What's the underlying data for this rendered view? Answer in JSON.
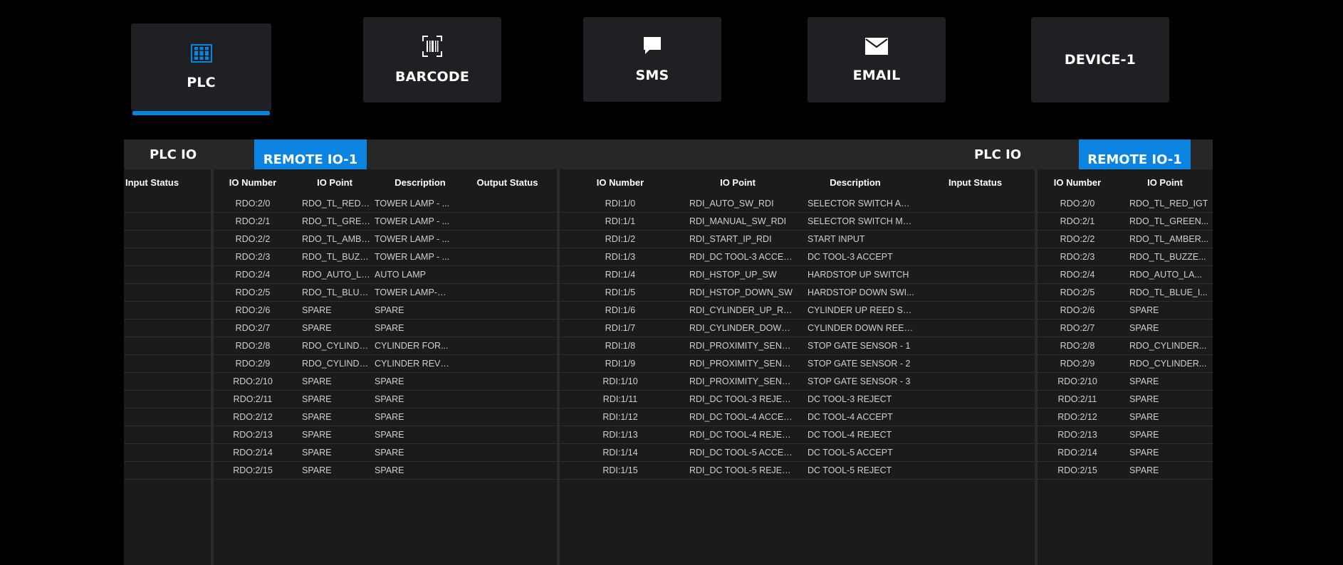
{
  "tabs": [
    {
      "key": "plc",
      "label": "PLC",
      "icon": "plc-icon",
      "active": true
    },
    {
      "key": "barcode",
      "label": "BARCODE",
      "icon": "barcode-icon",
      "active": false
    },
    {
      "key": "sms",
      "label": "SMS",
      "icon": "sms-icon",
      "active": false
    },
    {
      "key": "email",
      "label": "EMAIL",
      "icon": "email-icon",
      "active": false
    },
    {
      "key": "device1",
      "label": "DEVICE-1",
      "icon": "",
      "active": false
    }
  ],
  "colors": {
    "accent": "#0a84e0",
    "panel": "#1d1d1d",
    "tile": "#1f2023"
  },
  "panel": {
    "left_tab": "PLC IO",
    "left_active_tab": "REMOTE IO-1",
    "right_tab": "PLC IO",
    "right_active_tab": "REMOTE IO-1"
  },
  "tables": {
    "input_status_left": {
      "header": "Input Status"
    },
    "remote_out": {
      "headers": [
        "IO Number",
        "IO Point",
        "Description",
        "Output Status"
      ],
      "rows": [
        [
          "RDO:2/0",
          "RDO_TL_RED_IGT",
          "TOWER LAMP - ...",
          ""
        ],
        [
          "RDO:2/1",
          "RDO_TL_GREEN...",
          "TOWER LAMP - ...",
          ""
        ],
        [
          "RDO:2/2",
          "RDO_TL_AMBER...",
          "TOWER LAMP - ...",
          ""
        ],
        [
          "RDO:2/3",
          "RDO_TL_BUZZE...",
          "TOWER LAMP - ...",
          ""
        ],
        [
          "RDO:2/4",
          "RDO_AUTO_LA...",
          "AUTO LAMP",
          ""
        ],
        [
          "RDO:2/5",
          "RDO_TL_BLUE_I...",
          "TOWER LAMP-B...",
          ""
        ],
        [
          "RDO:2/6",
          "SPARE",
          "SPARE",
          ""
        ],
        [
          "RDO:2/7",
          "SPARE",
          "SPARE",
          ""
        ],
        [
          "RDO:2/8",
          "RDO_CYLINDER...",
          "CYLINDER FOR...",
          ""
        ],
        [
          "RDO:2/9",
          "RDO_CYLINDER...",
          "CYLINDER REVE...",
          ""
        ],
        [
          "RDO:2/10",
          "SPARE",
          "SPARE",
          ""
        ],
        [
          "RDO:2/11",
          "SPARE",
          "SPARE",
          ""
        ],
        [
          "RDO:2/12",
          "SPARE",
          "SPARE",
          ""
        ],
        [
          "RDO:2/13",
          "SPARE",
          "SPARE",
          ""
        ],
        [
          "RDO:2/14",
          "SPARE",
          "SPARE",
          ""
        ],
        [
          "RDO:2/15",
          "SPARE",
          "SPARE",
          ""
        ]
      ]
    },
    "remote_in": {
      "headers": [
        "IO Number",
        "IO Point",
        "Description",
        "Input Status"
      ],
      "rows": [
        [
          "RDI:1/0",
          "RDI_AUTO_SW_RDI",
          "SELECTOR SWITCH AUT...",
          ""
        ],
        [
          "RDI:1/1",
          "RDI_MANUAL_SW_RDI",
          "SELECTOR SWITCH MA...",
          ""
        ],
        [
          "RDI:1/2",
          "RDI_START_IP_RDI",
          "START INPUT",
          ""
        ],
        [
          "RDI:1/3",
          "RDI_DC TOOL-3 ACCEPT",
          "DC TOOL-3 ACCEPT",
          ""
        ],
        [
          "RDI:1/4",
          "RDI_HSTOP_UP_SW",
          "HARDSTOP UP SWITCH",
          ""
        ],
        [
          "RDI:1/5",
          "RDI_HSTOP_DOWN_SW",
          " HARDSTOP DOWN SWI...",
          ""
        ],
        [
          "RDI:1/6",
          "RDI_CYLINDER_UP_RSW",
          "CYLINDER UP REED SWI...",
          ""
        ],
        [
          "RDI:1/7",
          "RDI_CYLINDER_DOWN_...",
          "CYLINDER DOWN REED ...",
          ""
        ],
        [
          "RDI:1/8",
          "RDI_PROXIMITY_SENSO...",
          "STOP GATE SENSOR - 1",
          ""
        ],
        [
          "RDI:1/9",
          "RDI_PROXIMITY_SENSO...",
          "STOP GATE SENSOR - 2",
          ""
        ],
        [
          "RDI:1/10",
          "RDI_PROXIMITY_SENSO...",
          "STOP GATE SENSOR - 3",
          ""
        ],
        [
          "RDI:1/11",
          "RDI_DC TOOL-3 REJECT",
          "DC TOOL-3 REJECT",
          ""
        ],
        [
          "RDI:1/12",
          "RDI_DC TOOL-4 ACCEPT",
          "DC TOOL-4 ACCEPT",
          ""
        ],
        [
          "RDI:1/13",
          "RDI_DC TOOL-4 REJECT",
          "DC TOOL-4 REJECT",
          ""
        ],
        [
          "RDI:1/14",
          "RDI_DC TOOL-5 ACCEPT",
          "DC TOOL-5 ACCEPT",
          ""
        ],
        [
          "RDI:1/15",
          "RDI_DC TOOL-5 REJECT",
          "DC TOOL-5 REJECT",
          ""
        ]
      ]
    },
    "remote_out_right": {
      "headers": [
        "IO Number",
        "IO Point"
      ],
      "rows": [
        [
          "RDO:2/0",
          "RDO_TL_RED_IGT"
        ],
        [
          "RDO:2/1",
          "RDO_TL_GREEN..."
        ],
        [
          "RDO:2/2",
          "RDO_TL_AMBER..."
        ],
        [
          "RDO:2/3",
          "RDO_TL_BUZZE..."
        ],
        [
          "RDO:2/4",
          "RDO_AUTO_LA..."
        ],
        [
          "RDO:2/5",
          "RDO_TL_BLUE_I..."
        ],
        [
          "RDO:2/6",
          "SPARE"
        ],
        [
          "RDO:2/7",
          "SPARE"
        ],
        [
          "RDO:2/8",
          "RDO_CYLINDER..."
        ],
        [
          "RDO:2/9",
          "RDO_CYLINDER..."
        ],
        [
          "RDO:2/10",
          "SPARE"
        ],
        [
          "RDO:2/11",
          "SPARE"
        ],
        [
          "RDO:2/12",
          "SPARE"
        ],
        [
          "RDO:2/13",
          "SPARE"
        ],
        [
          "RDO:2/14",
          "SPARE"
        ],
        [
          "RDO:2/15",
          "SPARE"
        ]
      ]
    }
  }
}
